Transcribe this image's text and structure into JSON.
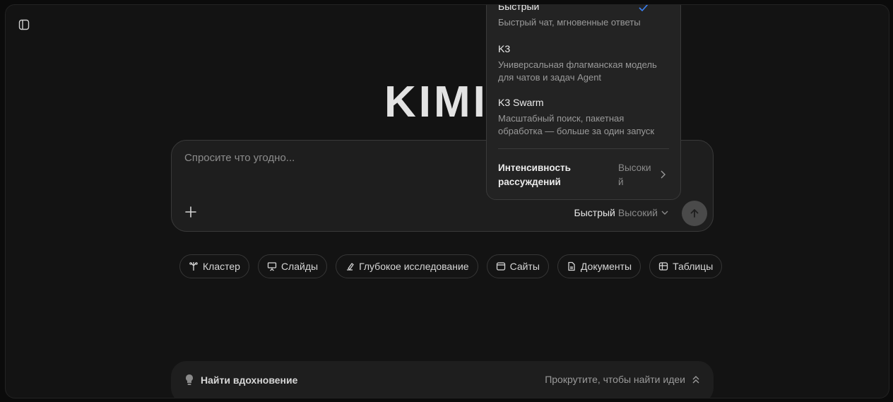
{
  "logo": {
    "text": "KIMI"
  },
  "composer": {
    "placeholder": "Спросите что угодно...",
    "model_name": "Быстрый",
    "model_level": "Высокий"
  },
  "chips": [
    {
      "label": "Кластер",
      "icon": "cluster-icon"
    },
    {
      "label": "Слайды",
      "icon": "slides-icon"
    },
    {
      "label": "Глубокое исследование",
      "icon": "research-icon"
    },
    {
      "label": "Сайты",
      "icon": "browser-icon"
    },
    {
      "label": "Документы",
      "icon": "document-icon"
    },
    {
      "label": "Таблицы",
      "icon": "table-icon"
    }
  ],
  "inspiration": {
    "label": "Найти вдохновение",
    "hint": "Прокрутите, чтобы найти идеи"
  },
  "dropdown": {
    "options": [
      {
        "title": "Быстрый",
        "desc": "Быстрый чат, мгновенные ответы",
        "selected": true
      },
      {
        "title": "K3",
        "desc": "Универсальная флагманская модель для чатов и задач Agent"
      },
      {
        "title": "K3 Swarm",
        "desc": "Масштабный поиск, пакетная обработка — больше за один запуск"
      }
    ],
    "intensity_label": "Интенсивность рассуждений",
    "intensity_value": "Высокий"
  },
  "colors": {
    "accent_check": "#3b82f6",
    "background": "#131313"
  }
}
